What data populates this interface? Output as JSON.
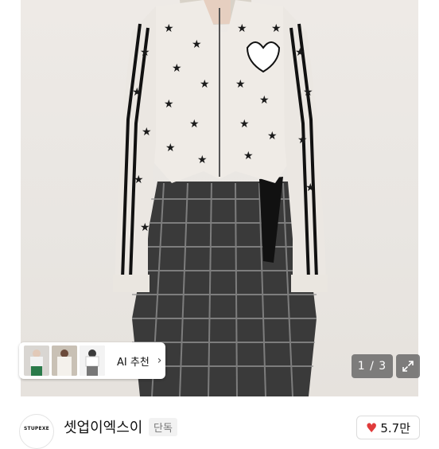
{
  "ai_recommend": {
    "label": "AI 추천",
    "chevron_icon": "chevron-right-icon"
  },
  "pager": {
    "text": "1 / 3"
  },
  "expand_icon": "expand-arrows-icon",
  "shop": {
    "logo_text": "STUPEXE",
    "name": "셋업이엑스이",
    "badge": "단독"
  },
  "likes": {
    "icon": "heart-icon",
    "count": "5.7만"
  },
  "colors": {
    "heart": "#e03b3b",
    "overlay": "#5a5a5a"
  }
}
